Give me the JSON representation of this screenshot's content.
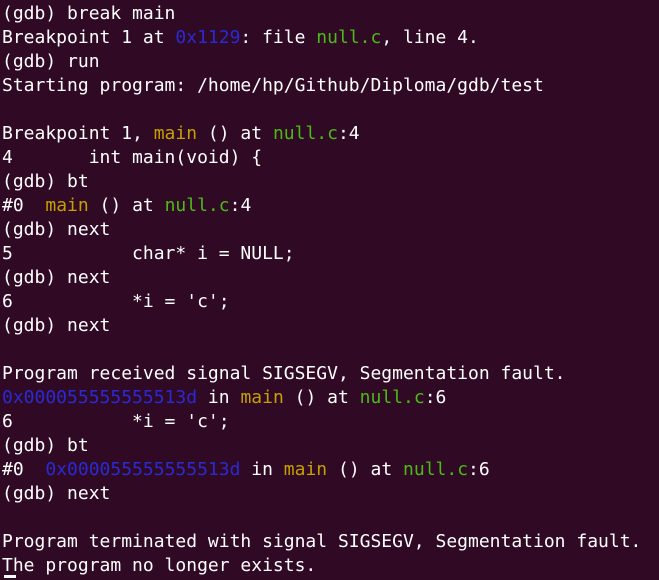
{
  "colors": {
    "background": "#300a24",
    "text": "#ffffff",
    "address": "#2a2ad4",
    "function": "#c4a000",
    "file": "#4cbb17"
  },
  "terminal": {
    "lines": [
      {
        "tokens": [
          {
            "t": "(gdb) break main",
            "c": "text"
          }
        ]
      },
      {
        "tokens": [
          {
            "t": "Breakpoint 1 at ",
            "c": "text"
          },
          {
            "t": "0x1129",
            "c": "address"
          },
          {
            "t": ": file ",
            "c": "text"
          },
          {
            "t": "null.c",
            "c": "file"
          },
          {
            "t": ", line 4.",
            "c": "text"
          }
        ]
      },
      {
        "tokens": [
          {
            "t": "(gdb) run",
            "c": "text"
          }
        ]
      },
      {
        "tokens": [
          {
            "t": "Starting program: /home/hp/Github/Diploma/gdb/test",
            "c": "text"
          }
        ]
      },
      {
        "tokens": []
      },
      {
        "tokens": [
          {
            "t": "Breakpoint 1, ",
            "c": "text"
          },
          {
            "t": "main",
            "c": "function"
          },
          {
            "t": " () at ",
            "c": "text"
          },
          {
            "t": "null.c",
            "c": "file"
          },
          {
            "t": ":4",
            "c": "text"
          }
        ]
      },
      {
        "tokens": [
          {
            "t": "4       int main(void) {",
            "c": "text"
          }
        ]
      },
      {
        "tokens": [
          {
            "t": "(gdb) bt",
            "c": "text"
          }
        ]
      },
      {
        "tokens": [
          {
            "t": "#0  ",
            "c": "text"
          },
          {
            "t": "main",
            "c": "function"
          },
          {
            "t": " () at ",
            "c": "text"
          },
          {
            "t": "null.c",
            "c": "file"
          },
          {
            "t": ":4",
            "c": "text"
          }
        ]
      },
      {
        "tokens": [
          {
            "t": "(gdb) next",
            "c": "text"
          }
        ]
      },
      {
        "tokens": [
          {
            "t": "5           char* i = NULL;",
            "c": "text"
          }
        ]
      },
      {
        "tokens": [
          {
            "t": "(gdb) next",
            "c": "text"
          }
        ]
      },
      {
        "tokens": [
          {
            "t": "6           *i = 'c';",
            "c": "text"
          }
        ]
      },
      {
        "tokens": [
          {
            "t": "(gdb) next",
            "c": "text"
          }
        ]
      },
      {
        "tokens": []
      },
      {
        "tokens": [
          {
            "t": "Program received signal SIGSEGV, Segmentation fault.",
            "c": "text"
          }
        ]
      },
      {
        "tokens": [
          {
            "t": "0x000055555555513d",
            "c": "address"
          },
          {
            "t": " in ",
            "c": "text"
          },
          {
            "t": "main",
            "c": "function"
          },
          {
            "t": " () at ",
            "c": "text"
          },
          {
            "t": "null.c",
            "c": "file"
          },
          {
            "t": ":6",
            "c": "text"
          }
        ]
      },
      {
        "tokens": [
          {
            "t": "6           *i = 'c';",
            "c": "text"
          }
        ]
      },
      {
        "tokens": [
          {
            "t": "(gdb) bt",
            "c": "text"
          }
        ]
      },
      {
        "tokens": [
          {
            "t": "#0  ",
            "c": "text"
          },
          {
            "t": "0x000055555555513d",
            "c": "address"
          },
          {
            "t": " in ",
            "c": "text"
          },
          {
            "t": "main",
            "c": "function"
          },
          {
            "t": " () at ",
            "c": "text"
          },
          {
            "t": "null.c",
            "c": "file"
          },
          {
            "t": ":6",
            "c": "text"
          }
        ]
      },
      {
        "tokens": [
          {
            "t": "(gdb) next",
            "c": "text"
          }
        ]
      },
      {
        "tokens": []
      },
      {
        "tokens": [
          {
            "t": "Program terminated with signal SIGSEGV, Segmentation fault.",
            "c": "text"
          }
        ]
      },
      {
        "tokens": [
          {
            "t": "The program no longer exists.",
            "c": "text"
          }
        ]
      }
    ]
  }
}
